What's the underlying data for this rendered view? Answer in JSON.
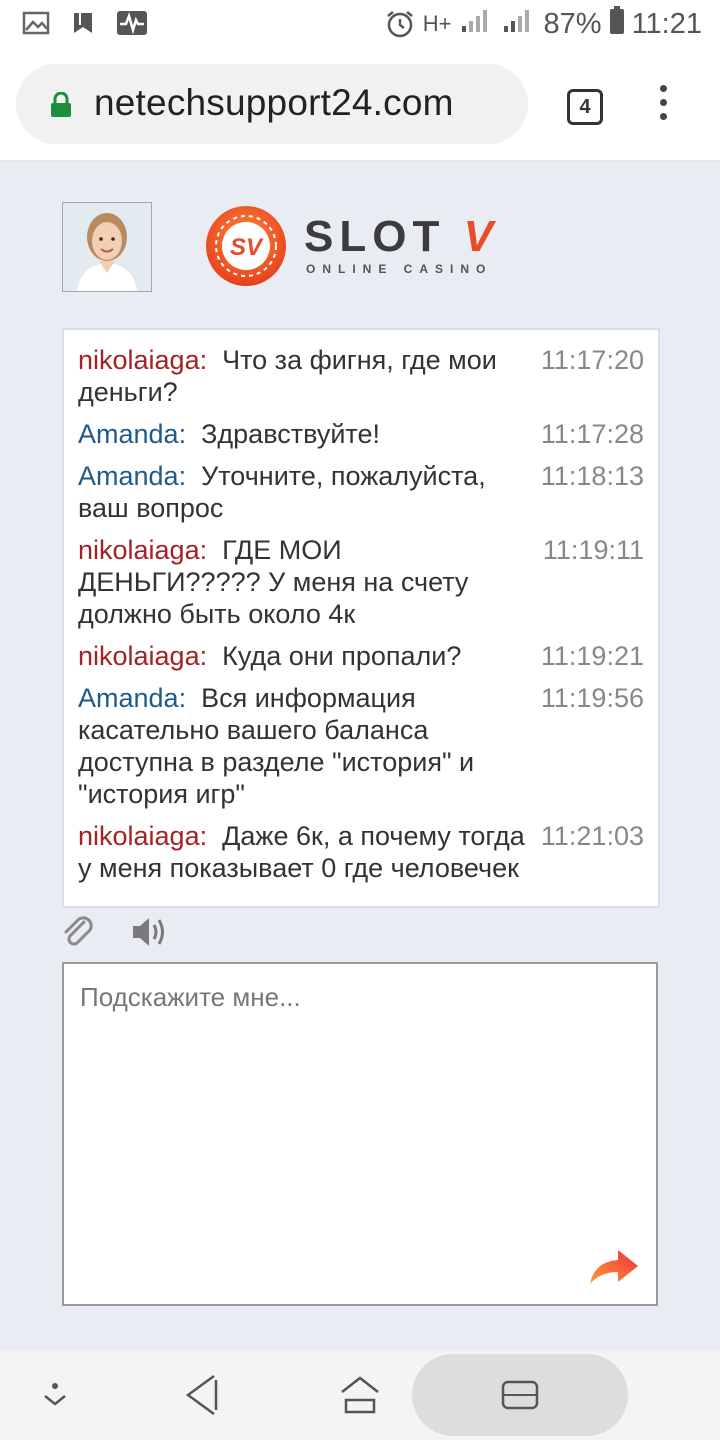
{
  "status_bar": {
    "network": "H+",
    "sim1": "1",
    "sim2": "2",
    "battery": "87%",
    "time": "11:21"
  },
  "browser": {
    "url": "netechsupport24.com",
    "tab_count": "4"
  },
  "chat": {
    "logo_big": "SLOT",
    "logo_v": "V",
    "logo_small": "ONLINE CASINO",
    "messages": [
      {
        "sender": "nikolaiaga:",
        "role": "user",
        "text": "Что за фигня, где мои деньги?",
        "time": "11:17:20"
      },
      {
        "sender": "Amanda:",
        "role": "agent",
        "text": "Здравствуйте!",
        "time": "11:17:28"
      },
      {
        "sender": "Amanda:",
        "role": "agent",
        "text": "Уточните, пожалуйста, ваш вопрос",
        "time": "11:18:13"
      },
      {
        "sender": "nikolaiaga:",
        "role": "user",
        "text": "ГДЕ МОИ ДЕНЬГИ????? У меня на счету должно быть около 4к",
        "time": "11:19:11"
      },
      {
        "sender": "nikolaiaga:",
        "role": "user",
        "text": "Куда они пропали?",
        "time": "11:19:21"
      },
      {
        "sender": "Amanda:",
        "role": "agent",
        "text": "Вся информация касательно вашего баланса доступна в разделе \"история\" и \"история игр\"",
        "time": "11:19:56"
      },
      {
        "sender": "nikolaiaga:",
        "role": "user",
        "text": "Даже 6к, а почему тогда у меня показывает 0 где человечек",
        "time": "11:21:03"
      }
    ],
    "input_placeholder": "Подскажите мне..."
  },
  "colors": {
    "user_name": "#a32222",
    "agent_name": "#1e5a8c",
    "page_bg": "#e9edf3",
    "accent": "#f26b2a"
  }
}
